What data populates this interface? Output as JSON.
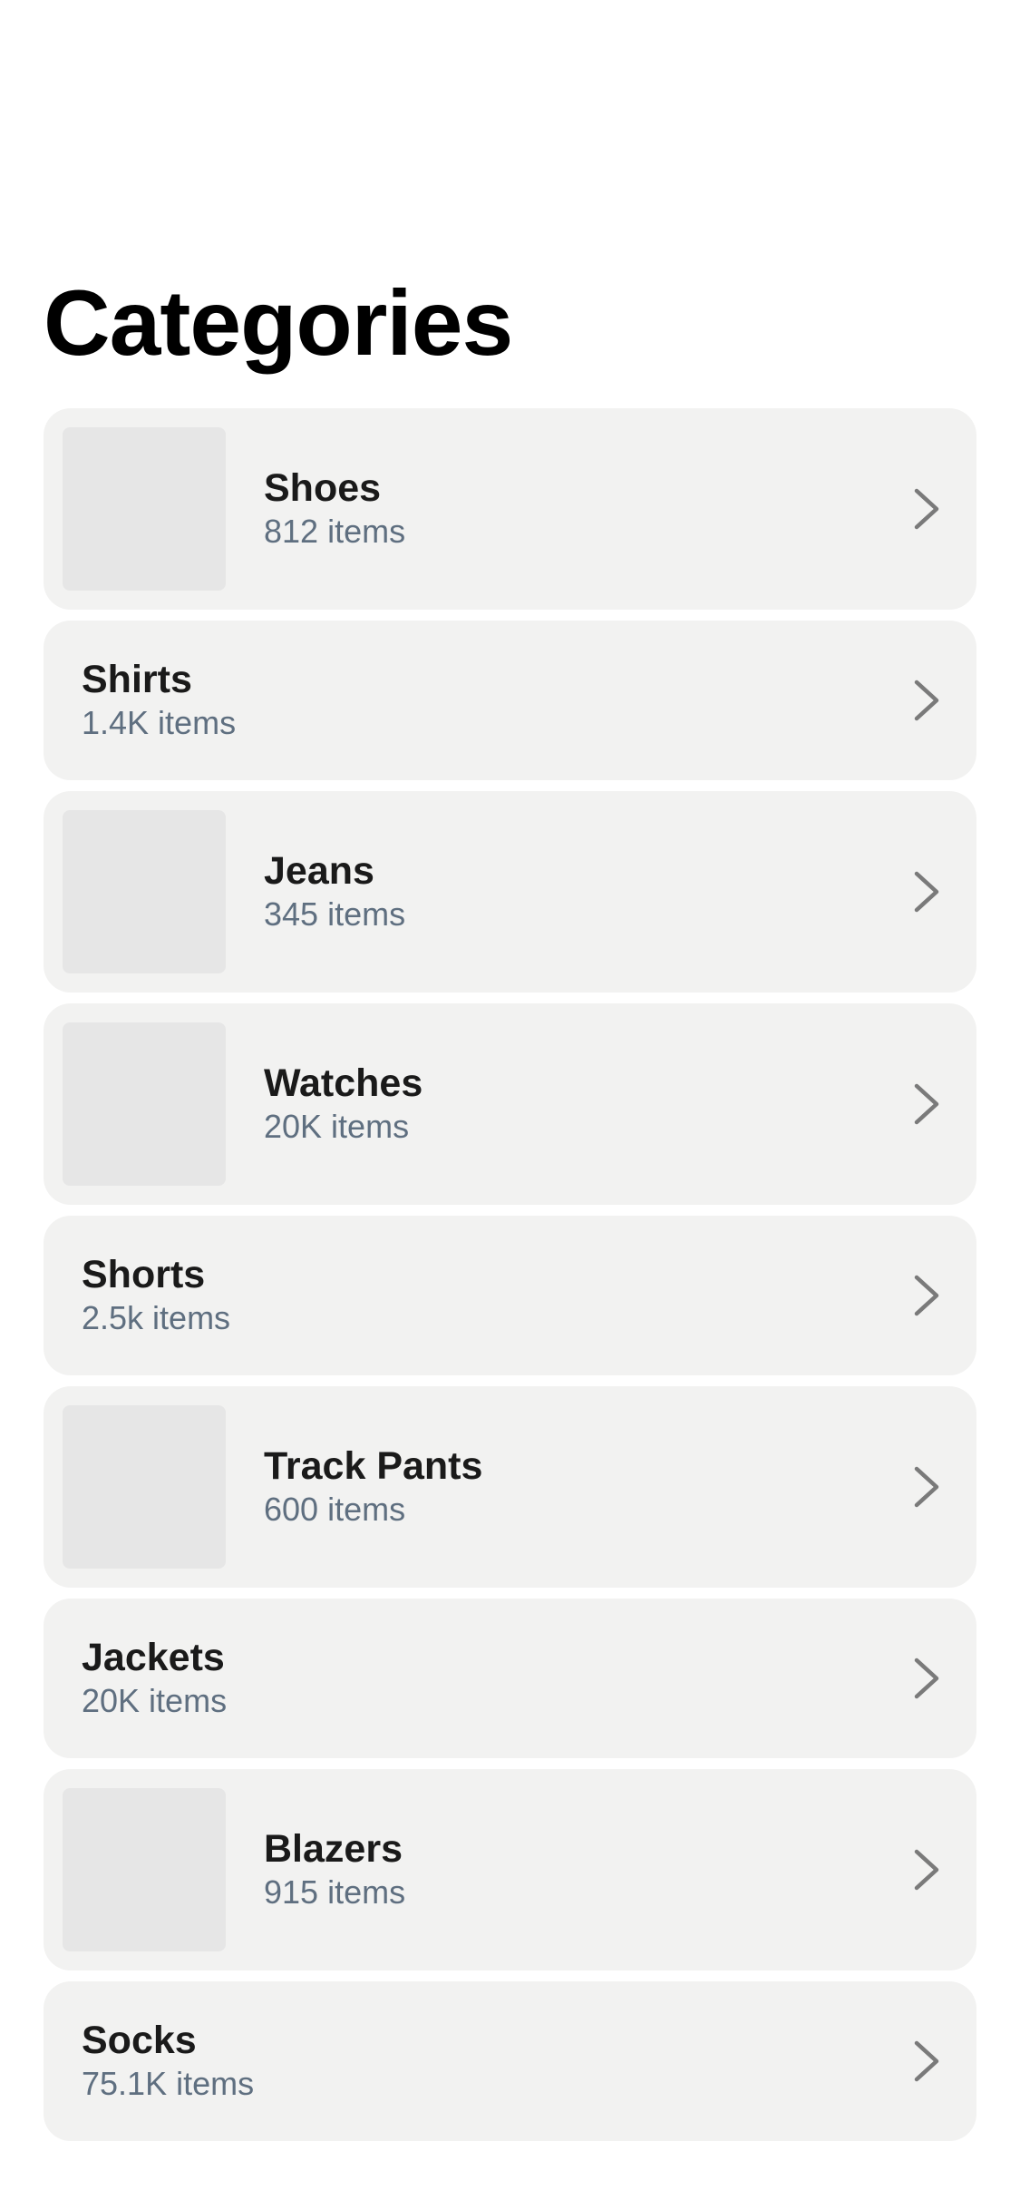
{
  "header": {
    "title": "Categories"
  },
  "categories": [
    {
      "name": "Shoes",
      "count": "812 items",
      "thumbnail": true
    },
    {
      "name": "Shirts",
      "count": "1.4K items",
      "thumbnail": false
    },
    {
      "name": "Jeans",
      "count": "345 items",
      "thumbnail": true
    },
    {
      "name": "Watches",
      "count": "20K items",
      "thumbnail": true
    },
    {
      "name": "Shorts",
      "count": "2.5k items",
      "thumbnail": false
    },
    {
      "name": "Track Pants",
      "count": "600 items",
      "thumbnail": true
    },
    {
      "name": "Jackets",
      "count": "20K items",
      "thumbnail": false
    },
    {
      "name": "Blazers",
      "count": "915 items",
      "thumbnail": true
    },
    {
      "name": "Socks",
      "count": "75.1K items",
      "thumbnail": false
    }
  ],
  "icons": {
    "row_chevron": "chevron-right-icon"
  },
  "colors": {
    "card_background": "#f2f2f1",
    "thumbnail_placeholder": "#e6e6e6",
    "title_text": "#000000",
    "item_name_text": "#1a1a1a",
    "item_count_text": "#5f6f80",
    "chevron": "#7a7a7a"
  }
}
